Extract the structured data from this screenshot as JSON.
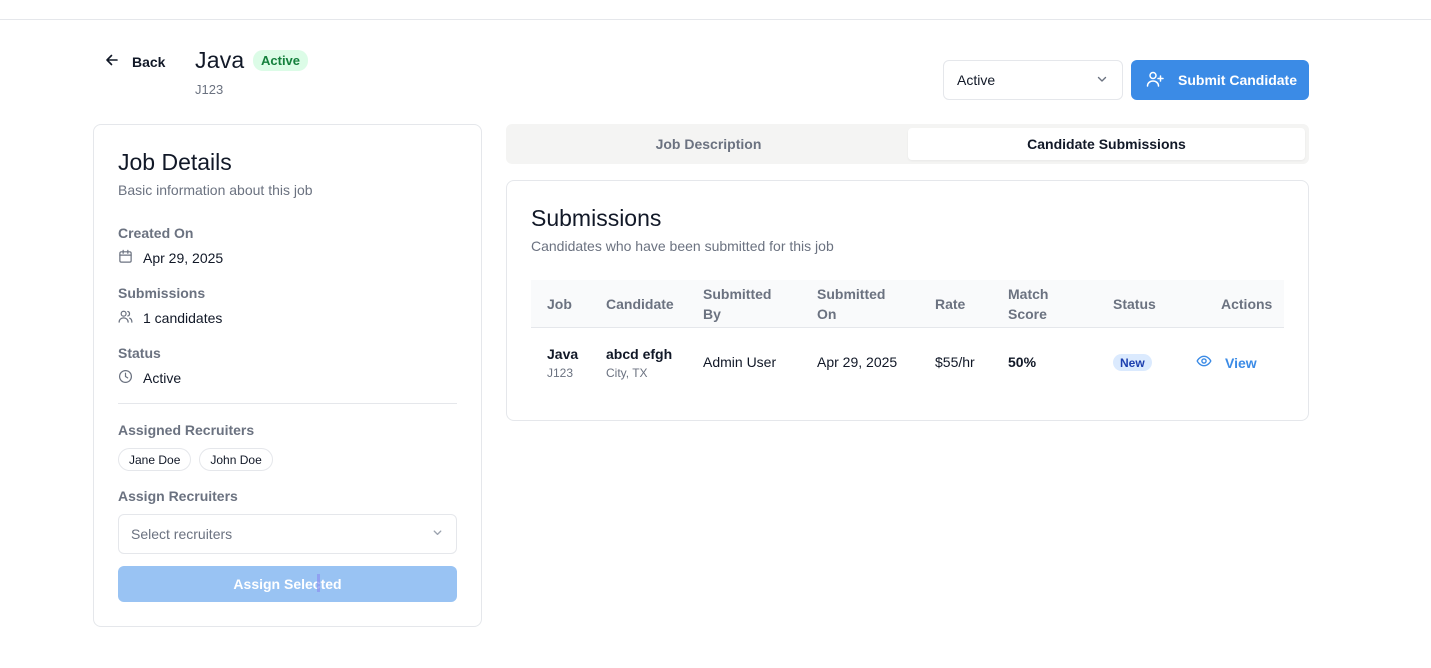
{
  "header": {
    "back_label": "Back",
    "job_title": "Java",
    "job_status_badge": "Active",
    "job_code": "J123",
    "status_select_value": "Active",
    "submit_button_label": "Submit Candidate"
  },
  "job_details": {
    "title": "Job Details",
    "subtitle": "Basic information about this job",
    "created_on_label": "Created On",
    "created_on_value": "Apr 29, 2025",
    "submissions_label": "Submissions",
    "submissions_value": "1 candidates",
    "status_label": "Status",
    "status_value": "Active",
    "assigned_recruiters_label": "Assigned Recruiters",
    "assigned_recruiters": [
      "Jane Doe",
      "John Doe"
    ],
    "assign_recruiters_label": "Assign Recruiters",
    "recruiter_select_placeholder": "Select recruiters",
    "assign_button_label": "Assign Selected"
  },
  "tabs": [
    {
      "label": "Job Description",
      "active": false
    },
    {
      "label": "Candidate Submissions",
      "active": true
    }
  ],
  "submissions": {
    "title": "Submissions",
    "subtitle": "Candidates who have been submitted for this job",
    "columns": [
      "Job",
      "Candidate",
      "Submitted\nBy",
      "Submitted\nOn",
      "Rate",
      "Match\nScore",
      "Status",
      "Actions"
    ],
    "columns_lines": [
      [
        "Job"
      ],
      [
        "Candidate"
      ],
      [
        "Submitted",
        "By"
      ],
      [
        "Submitted",
        "On"
      ],
      [
        "Rate"
      ],
      [
        "Match",
        "Score"
      ],
      [
        "Status"
      ],
      [
        "Actions"
      ]
    ],
    "rows": [
      {
        "job": "Java",
        "job_code": "J123",
        "candidate": "abcd efgh",
        "location": "City, TX",
        "submitted_by": "Admin User",
        "submitted_on": "Apr 29, 2025",
        "rate": "$55/hr",
        "match_score": "50%",
        "status": "New",
        "action": "View"
      }
    ]
  },
  "colors": {
    "primary": "#3b8be6",
    "active_badge_bg": "#dcfce7",
    "active_badge_text": "#15803d",
    "new_badge_bg": "#dbeafe",
    "disabled_button": "#99c3f3"
  },
  "icons": [
    "arrow-left-icon",
    "chevron-down-icon",
    "user-plus-icon",
    "calendar-icon",
    "users-icon",
    "clock-icon",
    "eye-icon"
  ]
}
